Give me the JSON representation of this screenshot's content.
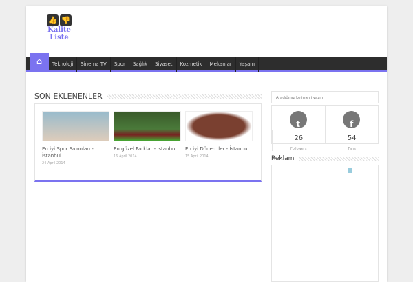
{
  "logo": {
    "line1": "Kalite",
    "line2": "Liste"
  },
  "nav": [
    "Teknoloji",
    "Sinema TV",
    "Spor",
    "Sağlık",
    "Siyaset",
    "Kozmetik",
    "Mekanlar",
    "Yaşam"
  ],
  "section": {
    "title": "SON EKLENENLER",
    "posts": [
      {
        "title": "En iyi Spor Salonları - İstanbul",
        "date": "24 April 2014",
        "color": "#8ab"
      },
      {
        "title": "En güzel Parklar - İstanbul",
        "date": "16 April 2014",
        "color": "#4a6a3a"
      },
      {
        "title": "En iyi Dönerciler - İstanbul",
        "date": "15 April 2014",
        "color": "#7a4030"
      }
    ]
  },
  "sidebar": {
    "search_placeholder": "Aradığınız kelimeyi yazın",
    "twitter": {
      "count": "26",
      "label": "Followers"
    },
    "facebook": {
      "count": "54",
      "label": "Fans"
    },
    "ad_title": "Reklam"
  }
}
